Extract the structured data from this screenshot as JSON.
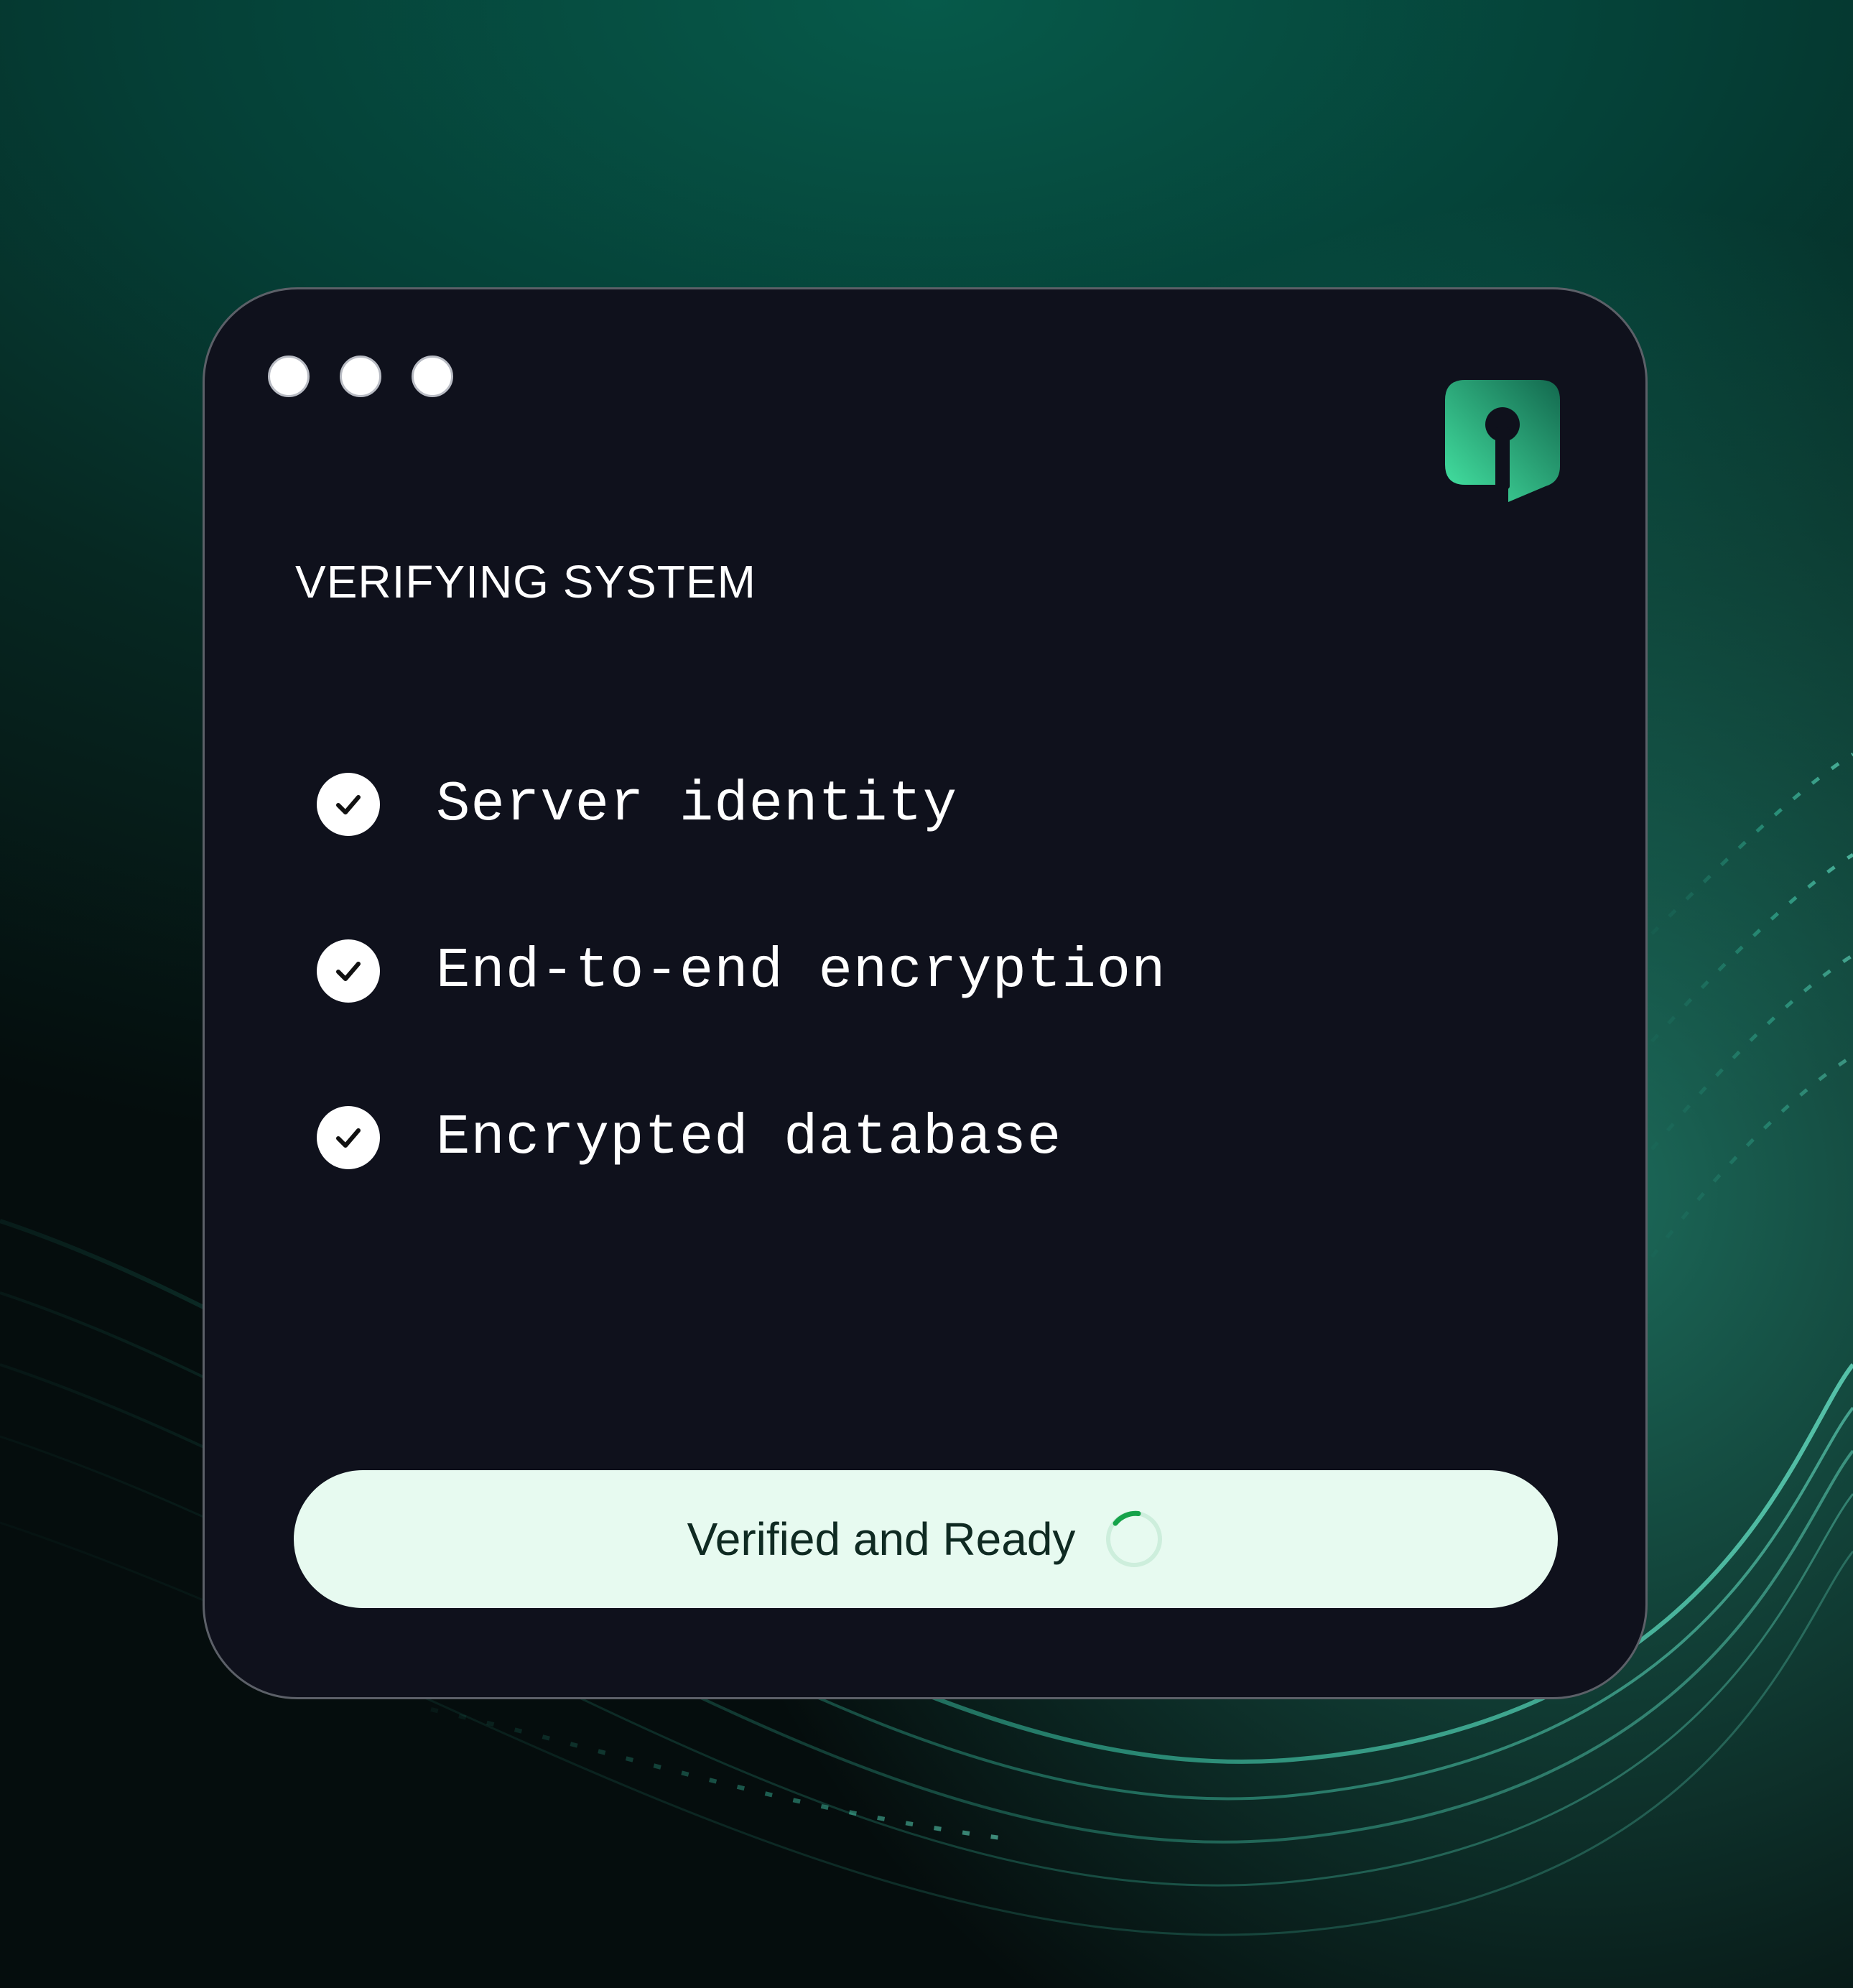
{
  "window": {
    "title": "VERIFYING SYSTEM",
    "controls": [
      "dot-1",
      "dot-2",
      "dot-3"
    ],
    "logo_icon": "keyhole-shield-icon"
  },
  "checklist": [
    {
      "label": "Server identity",
      "status": "complete",
      "icon": "check-circle-icon"
    },
    {
      "label": "End-to-end encryption",
      "status": "complete",
      "icon": "check-circle-icon"
    },
    {
      "label": "Encrypted database",
      "status": "complete",
      "icon": "check-circle-icon"
    }
  ],
  "status_button": {
    "label": "Verified and Ready",
    "icon": "loading-spinner-icon"
  },
  "colors": {
    "window_bg": "#0f111c",
    "accent_green": "#3ee4a0",
    "button_bg": "#e7faf0",
    "spinner_active": "#16a34a"
  }
}
